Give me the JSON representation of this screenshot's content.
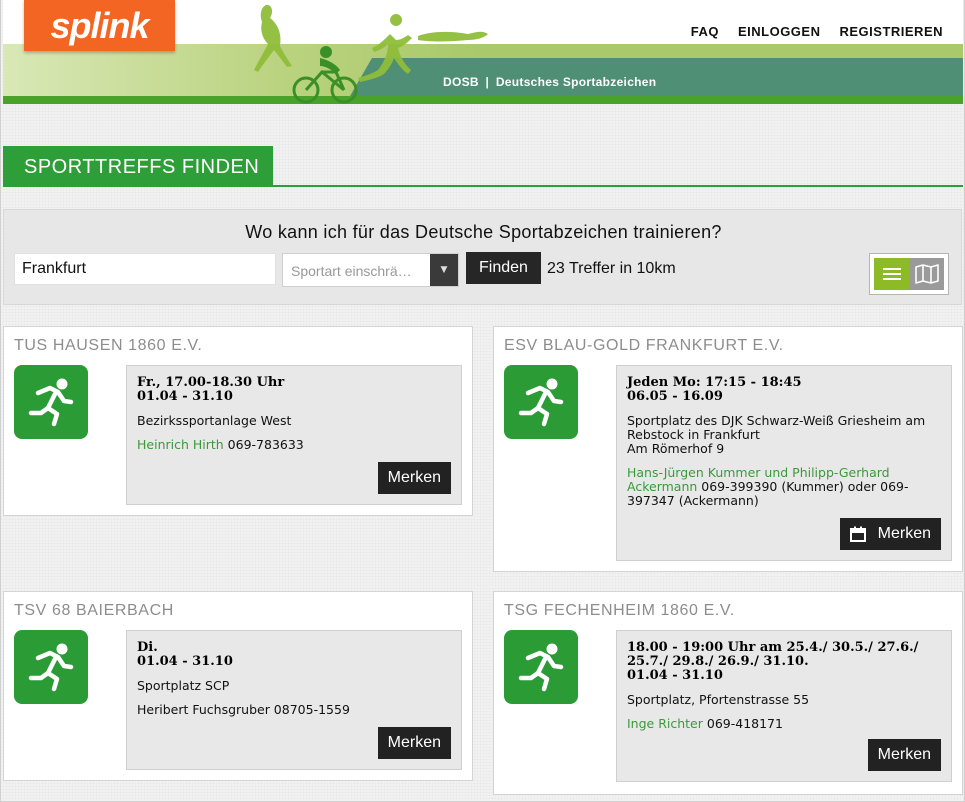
{
  "brand": {
    "logo": "splink"
  },
  "topnav": [
    {
      "label": "FAQ"
    },
    {
      "label": "EINLOGGEN"
    },
    {
      "label": "REGISTRIEREN"
    }
  ],
  "banner": {
    "org": "DOSB",
    "separator": "|",
    "program": "Deutsches Sportabzeichen"
  },
  "page_title": "SPORTTREFFS FINDEN",
  "search": {
    "question": "Wo kann ich für das Deutsche Sportabzeichen trainieren?",
    "location_value": "Frankfurt",
    "sport_placeholder": "Sportart einschrä…",
    "find_label": "Finden",
    "results": "23 Treffer in 10km"
  },
  "colors": {
    "brand": "#f26522",
    "accent_green": "#2e9e38",
    "toggle_active": "#8dbb25"
  },
  "cards": [
    {
      "club": "TUS HAUSEN 1860 E.V.",
      "schedule": [
        "Fr., 17.00-18.30 Uhr",
        "01.04 - 31.10"
      ],
      "place": [
        "Bezirkssportanlage West"
      ],
      "contact_name": "Heinrich Hirth",
      "contact_rest": " 069-783633",
      "button": "Merken"
    },
    {
      "club": "ESV BLAU-GOLD FRANKFURT E.V.",
      "schedule": [
        "Jeden Mo: 17:15 - 18:45",
        "06.05 - 16.09"
      ],
      "place": [
        "Sportplatz des DJK Schwarz-Weiß Griesheim am",
        "Rebstock in Frankfurt",
        "Am Römerhof 9"
      ],
      "contact_name": "Hans-Jürgen Kummer und Philipp-Gerhard Ackermann",
      "contact_rest": " 069-399390 (Kummer) oder 069-397347 (Ackermann)",
      "button": "Merken"
    },
    {
      "club": "TSV 68 BAIERBACH",
      "schedule": [
        "Di.",
        "01.04 - 31.10"
      ],
      "place": [
        "Sportplatz SCP"
      ],
      "contact_name": "",
      "contact_rest": "Heribert Fuchsgruber 08705-1559",
      "button": "Merken"
    },
    {
      "club": "TSG FECHENHEIM 1860 E.V.",
      "schedule": [
        "18.00 - 19:00 Uhr am 25.4./ 30.5./ 27.6./",
        "25.7./ 29.8./ 26.9./ 31.10.",
        "01.04 - 31.10"
      ],
      "place": [
        "Sportplatz, Pfortenstrasse 55"
      ],
      "contact_name": "Inge Richter",
      "contact_rest": " 069-418171",
      "button": "Merken"
    }
  ]
}
